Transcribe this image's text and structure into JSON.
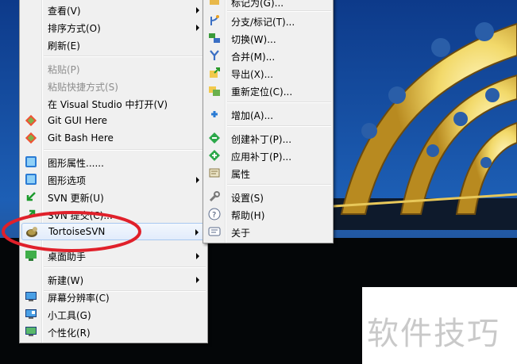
{
  "main_menu": {
    "items": [
      {
        "label": "查看(V)",
        "submenu": true
      },
      {
        "label": "排序方式(O)",
        "submenu": true
      },
      {
        "label": "刷新(E)"
      },
      {
        "label": "粘贴(P)",
        "disabled": true
      },
      {
        "label": "粘贴快捷方式(S)",
        "disabled": true
      },
      {
        "label": "在 Visual Studio 中打开(V)"
      },
      {
        "label": "Git GUI Here"
      },
      {
        "label": "Git Bash Here"
      },
      {
        "label": "图形属性......"
      },
      {
        "label": "图形选项",
        "submenu": true
      },
      {
        "label": "SVN 更新(U)"
      },
      {
        "label": "SVN 提交(C)..."
      },
      {
        "label": "TortoiseSVN",
        "submenu": true
      },
      {
        "label": "桌面助手",
        "submenu": true
      },
      {
        "label": "新建(W)",
        "submenu": true
      },
      {
        "label": "屏幕分辨率(C)"
      },
      {
        "label": "小工具(G)"
      },
      {
        "label": "个性化(R)"
      }
    ]
  },
  "sub_menu": {
    "items": [
      {
        "label": "标记为(G)..."
      },
      {
        "label": "分支/标记(T)..."
      },
      {
        "label": "切换(W)..."
      },
      {
        "label": "合并(M)..."
      },
      {
        "label": "导出(X)..."
      },
      {
        "label": "重新定位(C)..."
      },
      {
        "label": "增加(A)..."
      },
      {
        "label": "创建补丁(P)..."
      },
      {
        "label": "应用补丁(P)..."
      },
      {
        "label": "属性"
      },
      {
        "label": "设置(S)"
      },
      {
        "label": "帮助(H)"
      },
      {
        "label": "关于"
      }
    ]
  },
  "watermark": {
    "text": "软件技巧"
  },
  "colors": {
    "annotation": "#e0202a",
    "highlight_border": "#a8c8f0",
    "menu_bg": "#f0f0f0"
  }
}
